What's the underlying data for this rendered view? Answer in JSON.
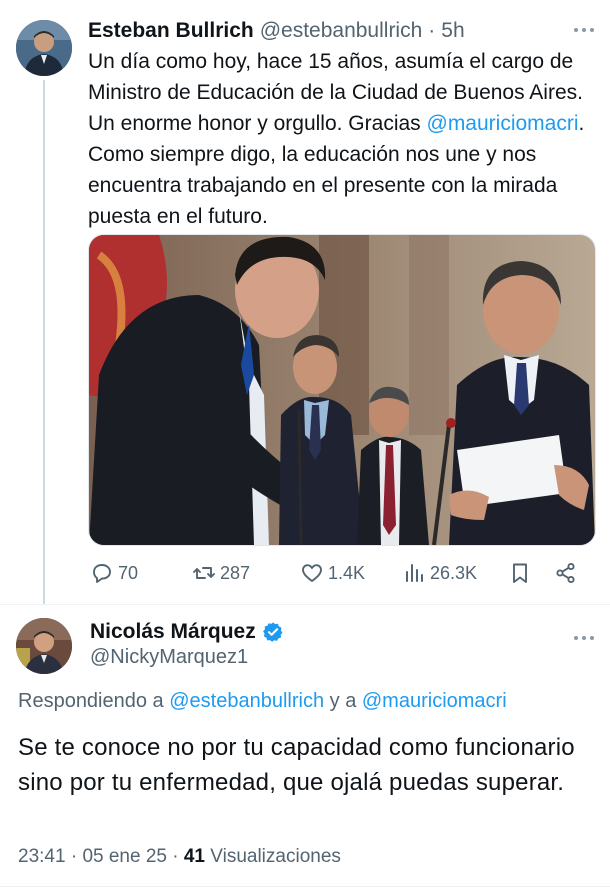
{
  "tweet": {
    "author_name": "Esteban Bullrich",
    "handle": "@estebanbullrich",
    "separator": "·",
    "time": "5h",
    "text_before": "Un día como hoy, hace 15 años, asumía el cargo de Ministro de Educación de la Ciudad de Buenos Aires. Un enorme honor y orgullo. Gracias ",
    "mention": "@mauriciomacri",
    "text_after": ". Como siempre digo, la educación nos une y nos encuentra trabajando en el presente con la mirada puesta en el futuro.",
    "actions": {
      "replies": "70",
      "reposts": "287",
      "likes": "1.4K",
      "views": "26.3K"
    }
  },
  "reply": {
    "author_name": "Nicolás Márquez",
    "handle": "@NickyMarquez1",
    "replying_prefix": "Respondiendo a ",
    "replying_mention1": "@estebanbullrich",
    "replying_and": " y a ",
    "replying_mention2": "@mauriciomacri",
    "text": "Se te conoce no por tu capacidad como funcionario sino por tu enfermedad, que ojalá puedas superar.",
    "time": "23:41",
    "date": "05 ene 25",
    "views_count": "41",
    "views_label": "Visualizaciones"
  },
  "colors": {
    "accent": "#1d9bf0",
    "text": "#0f1419",
    "secondary": "#536471"
  }
}
